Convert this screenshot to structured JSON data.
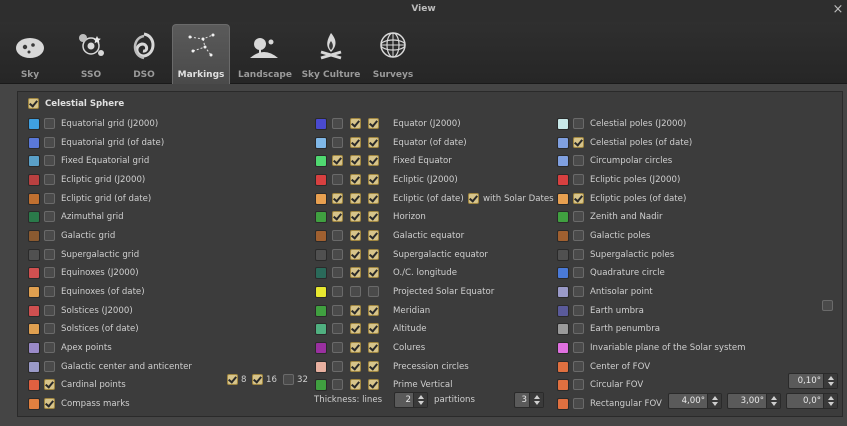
{
  "window": {
    "title": "View",
    "close_glyph": "×"
  },
  "tabs": [
    {
      "label": "Sky",
      "icon": "sky-icon",
      "active": false
    },
    {
      "label": "SSO",
      "icon": "solar-system-icon",
      "active": false
    },
    {
      "label": "DSO",
      "icon": "galaxy-icon",
      "active": false
    },
    {
      "label": "Markings",
      "icon": "constellation-icon",
      "active": true
    },
    {
      "label": "Landscape",
      "icon": "landscape-icon",
      "active": false
    },
    {
      "label": "Sky Culture",
      "icon": "campfire-icon",
      "active": false
    },
    {
      "label": "Surveys",
      "icon": "sphere-icon",
      "active": false
    }
  ],
  "celestial_sphere": {
    "label": "Celestial Sphere",
    "checked": true
  },
  "col1": [
    {
      "label": "Equatorial grid (J2000)",
      "color": "#3fa0e0",
      "checked": false
    },
    {
      "label": "Equatorial grid (of date)",
      "color": "#5a78d8",
      "checked": false
    },
    {
      "label": "Fixed Equatorial grid",
      "color": "#5aa0c8",
      "checked": false
    },
    {
      "label": "Ecliptic grid (J2000)",
      "color": "#b84040",
      "checked": false
    },
    {
      "label": "Ecliptic grid (of date)",
      "color": "#c07030",
      "checked": false
    },
    {
      "label": "Azimuthal grid",
      "color": "#2a7a4a",
      "checked": false
    },
    {
      "label": "Galactic grid",
      "color": "#8a5a30",
      "checked": false
    },
    {
      "label": "Supergalactic grid",
      "color": "#505050",
      "checked": false
    },
    {
      "label": "Equinoxes (J2000)",
      "color": "#d05050",
      "checked": false
    },
    {
      "label": "Equinoxes (of date)",
      "color": "#e0a050",
      "checked": false
    },
    {
      "label": "Solstices (J2000)",
      "color": "#d05050",
      "checked": false
    },
    {
      "label": "Solstices (of date)",
      "color": "#e0a050",
      "checked": false
    },
    {
      "label": "Apex points",
      "color": "#9a8ac8",
      "checked": false
    },
    {
      "label": "Galactic center and anticenter",
      "color": "#9a9ac8",
      "checked": false
    },
    {
      "label": "Cardinal points",
      "color": "#e06040",
      "checked": true
    },
    {
      "label": "Compass marks",
      "color": "#e08040",
      "checked": true
    }
  ],
  "cardinal_extras": [
    {
      "label": "8",
      "checked": true
    },
    {
      "label": "16",
      "checked": true
    },
    {
      "label": "32",
      "checked": false
    }
  ],
  "col2": [
    {
      "label": "Equator (J2000)",
      "color": "#4a4ad0",
      "c1": false,
      "c2": true,
      "c3": true
    },
    {
      "label": "Equator (of date)",
      "color": "#80b8e8",
      "c1": false,
      "c2": true,
      "c3": true
    },
    {
      "label": "Fixed Equator",
      "color": "#50d870",
      "c1": true,
      "c2": true,
      "c3": true
    },
    {
      "label": "Ecliptic (J2000)",
      "color": "#d84040",
      "c1": false,
      "c2": true,
      "c3": true
    },
    {
      "label": "Ecliptic (of date)",
      "color": "#e8a050",
      "c1": true,
      "c2": true,
      "c3": true,
      "extra_label": "with Solar Dates",
      "extra_checked": true
    },
    {
      "label": "Horizon",
      "color": "#40a040",
      "c1": true,
      "c2": true,
      "c3": true
    },
    {
      "label": "Galactic equator",
      "color": "#a06030",
      "c1": false,
      "c2": true,
      "c3": true
    },
    {
      "label": "Supergalactic equator",
      "color": "#505050",
      "c1": false,
      "c2": true,
      "c3": true
    },
    {
      "label": "O./C. longitude",
      "color": "#2a6a5a",
      "c1": false,
      "c2": true,
      "c3": true
    },
    {
      "label": "Projected Solar Equator",
      "color": "#e8e830",
      "c1": false,
      "c2": false,
      "c3": false
    },
    {
      "label": "Meridian",
      "color": "#40a040",
      "c1": false,
      "c2": true,
      "c3": true
    },
    {
      "label": "Altitude",
      "color": "#50b080",
      "c1": false,
      "c2": true,
      "c3": true
    },
    {
      "label": "Colures",
      "color": "#9a30a0",
      "c1": false,
      "c2": true,
      "c3": true
    },
    {
      "label": "Precession circles",
      "color": "#e8b0a0",
      "c1": false,
      "c2": true,
      "c3": true
    },
    {
      "label": "Prime Vertical",
      "color": "#40a040",
      "c1": false,
      "c2": true,
      "c3": true
    }
  ],
  "thickness": {
    "label": "Thickness: lines",
    "lines_value": "2",
    "partitions_label": "partitions",
    "partitions_value": "3"
  },
  "col3": [
    {
      "label": "Celestial poles (J2000)",
      "color": "#c8e8e8",
      "checked": false
    },
    {
      "label": "Celestial poles (of date)",
      "color": "#80a0e0",
      "checked": true
    },
    {
      "label": "Circumpolar circles",
      "color": "#80a0e0",
      "checked": false
    },
    {
      "label": "Ecliptic poles (J2000)",
      "color": "#d84040",
      "checked": false
    },
    {
      "label": "Ecliptic poles (of date)",
      "color": "#e8a050",
      "checked": true
    },
    {
      "label": "Zenith and Nadir",
      "color": "#40a040",
      "checked": false
    },
    {
      "label": "Galactic poles",
      "color": "#a06030",
      "checked": false
    },
    {
      "label": "Supergalactic poles",
      "color": "#505050",
      "checked": false
    },
    {
      "label": "Quadrature circle",
      "color": "#4a7ad8",
      "checked": false
    },
    {
      "label": "Antisolar point",
      "color": "#9a9ac8",
      "checked": false
    },
    {
      "label": "Earth umbra",
      "color": "#5a5a9a",
      "checked": false
    },
    {
      "label": "Earth penumbra",
      "color": "#9a9a9a",
      "checked": false
    },
    {
      "label": "Invariable plane of the Solar system",
      "color": "#e070e0",
      "checked": false
    },
    {
      "label": "Center of FOV",
      "color": "#e07040",
      "checked": false
    },
    {
      "label": "Circular FOV",
      "color": "#e07040",
      "checked": false
    },
    {
      "label": "Rectangular FOV",
      "color": "#e07040",
      "checked": false
    }
  ],
  "earth_umbra_right_checked": false,
  "circular_fov_value": "0,10°",
  "rect_fov_values": [
    "4,00°",
    "3,00°",
    "0,0°"
  ]
}
